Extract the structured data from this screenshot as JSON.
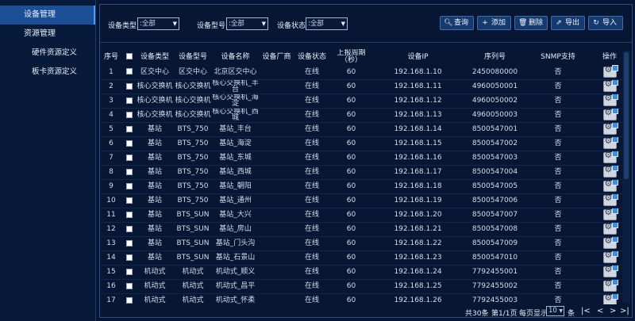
{
  "sidebar": {
    "items": [
      {
        "label": "设备管理",
        "level": 1,
        "active": true
      },
      {
        "label": "资源管理",
        "level": 1,
        "active": false
      },
      {
        "label": "硬件资源定义",
        "level": 2,
        "active": false
      },
      {
        "label": "板卡资源定义",
        "level": 2,
        "active": false
      }
    ]
  },
  "filters": {
    "device_type_label": "设备类型",
    "device_type_value": ":全部",
    "device_model_label": "设备型号",
    "device_model_value": ":全部",
    "device_status_label": "设备状态",
    "device_status_value": ":全部"
  },
  "toolbar": {
    "query_label": "查询",
    "add_label": "添加",
    "delete_label": "删除",
    "export_label": "导出",
    "import_label": "导入"
  },
  "table": {
    "headers": [
      "序号",
      "",
      "设备类型",
      "设备型号",
      "设备名称",
      "设备厂商",
      "设备状态",
      "上报周期（秒）",
      "设备IP",
      "序列号",
      "SNMP支持",
      "操作"
    ],
    "rows": [
      {
        "no": "1",
        "type": "区交中心",
        "model": "区交中心",
        "name": "北京区交中心",
        "vendor": "",
        "status": "在线",
        "period": "60",
        "ip": "192.168.1.10",
        "serial": "2450080000",
        "snmp": "否"
      },
      {
        "no": "2",
        "type": "核心交换机",
        "model": "核心交换机",
        "name": "核心交换机_丰台",
        "vendor": "",
        "status": "在线",
        "period": "60",
        "ip": "192.168.1.11",
        "serial": "4960050001",
        "snmp": "否"
      },
      {
        "no": "3",
        "type": "核心交换机",
        "model": "核心交换机",
        "name": "核心交换机_海淀",
        "vendor": "",
        "status": "在线",
        "period": "60",
        "ip": "192.168.1.12",
        "serial": "4960050002",
        "snmp": "否"
      },
      {
        "no": "4",
        "type": "核心交换机",
        "model": "核心交换机",
        "name": "核心交换机_西城",
        "vendor": "",
        "status": "在线",
        "period": "60",
        "ip": "192.168.1.13",
        "serial": "4960050003",
        "snmp": "否"
      },
      {
        "no": "5",
        "type": "基站",
        "model": "BTS_750",
        "name": "基站_丰台",
        "vendor": "",
        "status": "在线",
        "period": "60",
        "ip": "192.168.1.14",
        "serial": "8500547001",
        "snmp": "否"
      },
      {
        "no": "6",
        "type": "基站",
        "model": "BTS_750",
        "name": "基站_海淀",
        "vendor": "",
        "status": "在线",
        "period": "60",
        "ip": "192.168.1.15",
        "serial": "8500547002",
        "snmp": "否"
      },
      {
        "no": "7",
        "type": "基站",
        "model": "BTS_750",
        "name": "基站_东城",
        "vendor": "",
        "status": "在线",
        "period": "60",
        "ip": "192.168.1.16",
        "serial": "8500547003",
        "snmp": "否"
      },
      {
        "no": "8",
        "type": "基站",
        "model": "BTS_750",
        "name": "基站_西城",
        "vendor": "",
        "status": "在线",
        "period": "60",
        "ip": "192.168.1.17",
        "serial": "8500547004",
        "snmp": "否"
      },
      {
        "no": "9",
        "type": "基站",
        "model": "BTS_750",
        "name": "基站_朝阳",
        "vendor": "",
        "status": "在线",
        "period": "60",
        "ip": "192.168.1.18",
        "serial": "8500547005",
        "snmp": "否"
      },
      {
        "no": "10",
        "type": "基站",
        "model": "BTS_750",
        "name": "基站_通州",
        "vendor": "",
        "status": "在线",
        "period": "60",
        "ip": "192.168.1.19",
        "serial": "8500547006",
        "snmp": "否"
      },
      {
        "no": "11",
        "type": "基站",
        "model": "BTS_SUN",
        "name": "基站_大兴",
        "vendor": "",
        "status": "在线",
        "period": "60",
        "ip": "192.168.1.20",
        "serial": "8500547007",
        "snmp": "否"
      },
      {
        "no": "12",
        "type": "基站",
        "model": "BTS_SUN",
        "name": "基站_房山",
        "vendor": "",
        "status": "在线",
        "period": "60",
        "ip": "192.168.1.21",
        "serial": "8500547008",
        "snmp": "否"
      },
      {
        "no": "13",
        "type": "基站",
        "model": "BTS_SUN",
        "name": "基站_门头沟",
        "vendor": "",
        "status": "在线",
        "period": "60",
        "ip": "192.168.1.22",
        "serial": "8500547009",
        "snmp": "否"
      },
      {
        "no": "14",
        "type": "基站",
        "model": "BTS_SUN",
        "name": "基站_石景山",
        "vendor": "",
        "status": "在线",
        "period": "60",
        "ip": "192.168.1.23",
        "serial": "8500547010",
        "snmp": "否"
      },
      {
        "no": "15",
        "type": "机动式",
        "model": "机动式",
        "name": "机动式_顺义",
        "vendor": "",
        "status": "在线",
        "period": "60",
        "ip": "192.168.1.24",
        "serial": "7792455001",
        "snmp": "否"
      },
      {
        "no": "16",
        "type": "机动式",
        "model": "机动式",
        "name": "机动式_昌平",
        "vendor": "",
        "status": "在线",
        "period": "60",
        "ip": "192.168.1.25",
        "serial": "7792455002",
        "snmp": "否"
      },
      {
        "no": "17",
        "type": "机动式",
        "model": "机动式",
        "name": "机动式_怀柔",
        "vendor": "",
        "status": "在线",
        "period": "60",
        "ip": "192.168.1.26",
        "serial": "7792455003",
        "snmp": "否"
      }
    ]
  },
  "pager": {
    "total_text": "共30条",
    "page_text": "第1/1页",
    "per_page_label": "每页显示",
    "per_page_value": "10",
    "unit": "条",
    "first": "|<",
    "prev": "<",
    "next": ">",
    "last": ">|"
  },
  "colors": {
    "background": "#061633",
    "accent": "#1b4f96",
    "button": "#163a6e"
  }
}
